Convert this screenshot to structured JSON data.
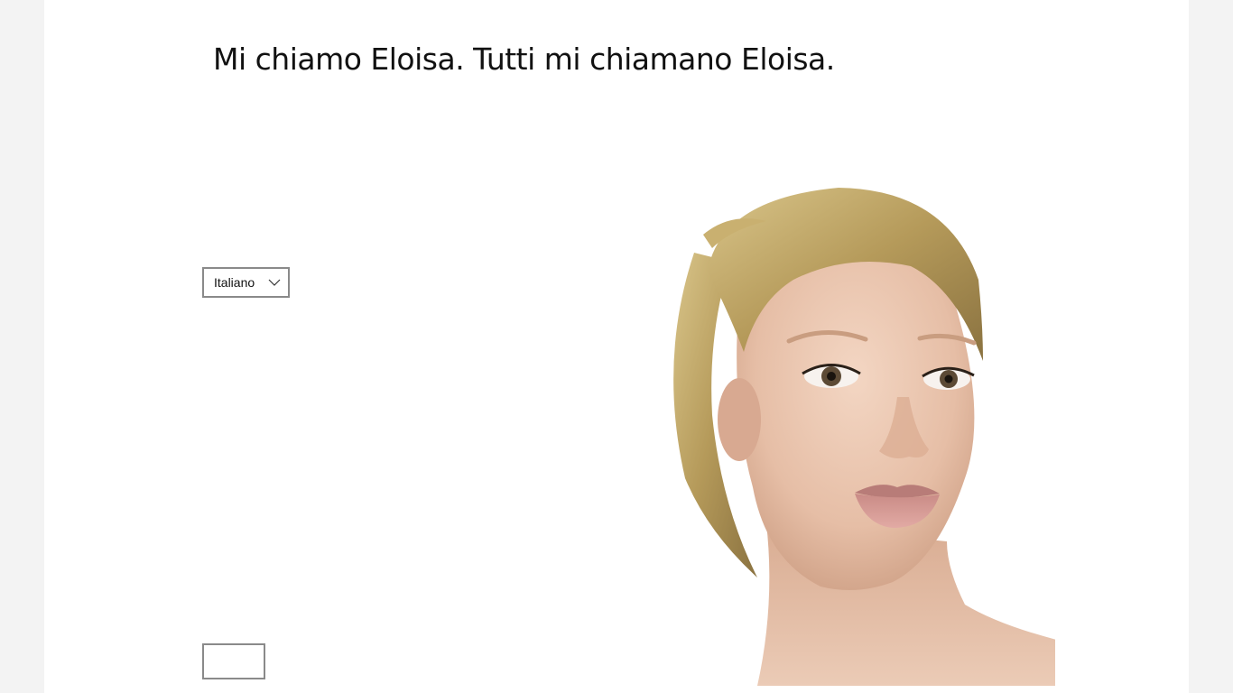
{
  "speech": {
    "text": "Mi chiamo Eloisa. Tutti mi chiamano Eloisa."
  },
  "language_select": {
    "selected": "Italiano",
    "icon": "chevron-down-icon"
  },
  "chat_input": {
    "value": "",
    "placeholder": ""
  },
  "avatar": {
    "description_icon": "avatar-face-render"
  },
  "colors": {
    "background": "#ffffff",
    "border": "#8a8a8a",
    "text": "#111111"
  }
}
